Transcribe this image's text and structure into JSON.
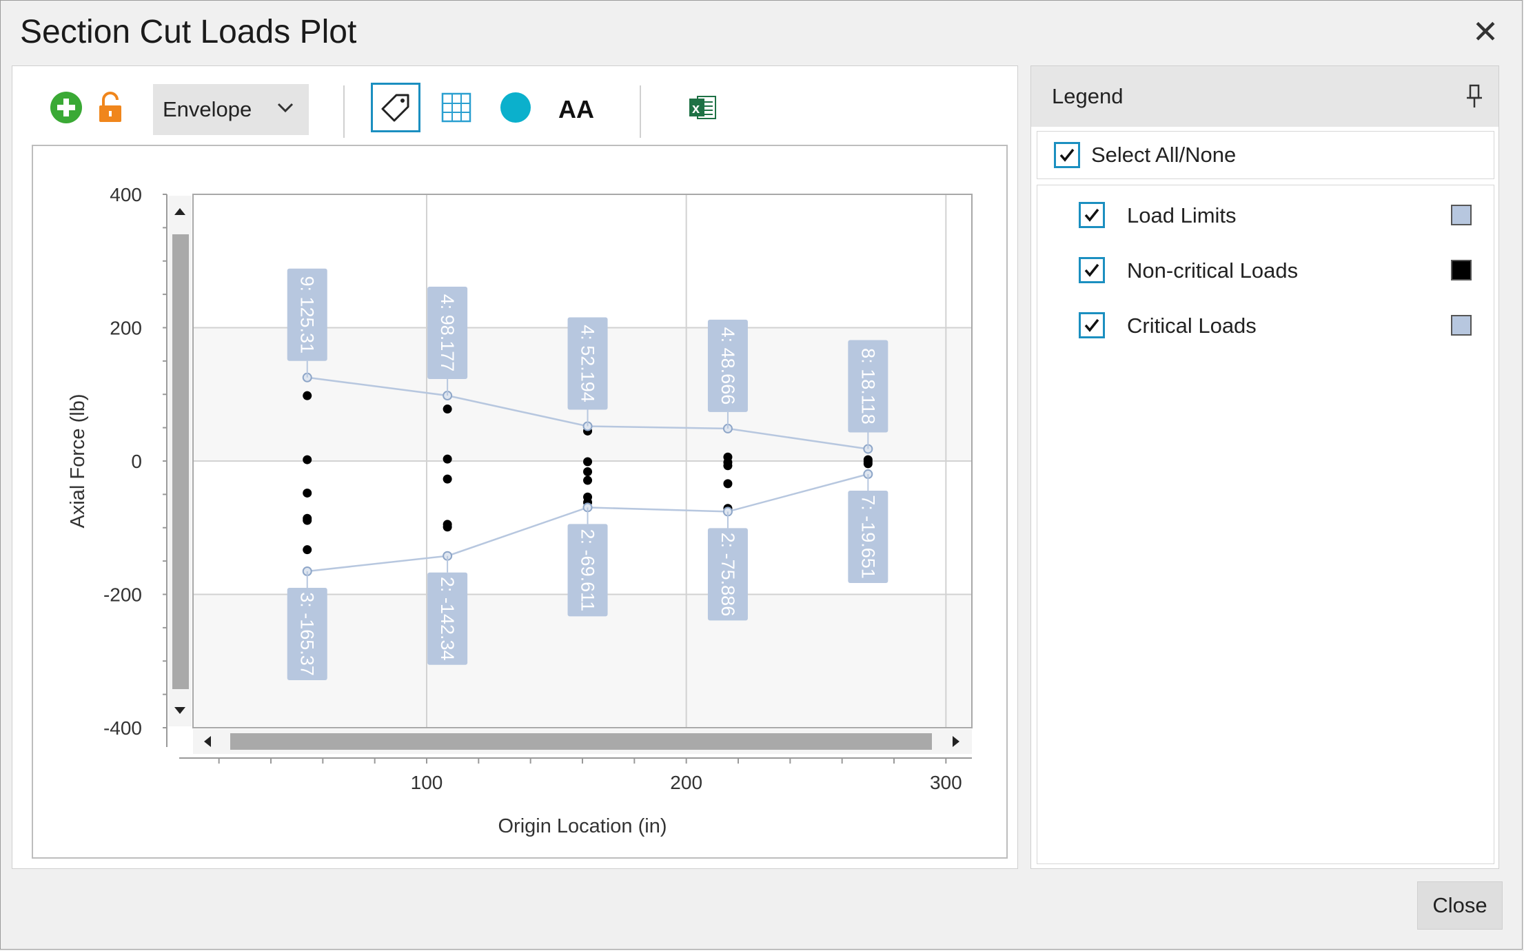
{
  "window": {
    "title": "Section Cut Loads Plot"
  },
  "toolbar": {
    "dropdown_value": "Envelope"
  },
  "legend": {
    "title": "Legend",
    "select_all_label": "Select All/None",
    "items": [
      {
        "label": "Load Limits",
        "color": "#b7c7df",
        "checked": true
      },
      {
        "label": "Non-critical Loads",
        "color": "#000000",
        "checked": true
      },
      {
        "label": "Critical Loads",
        "color": "#b7c7df",
        "checked": true
      }
    ]
  },
  "footer": {
    "close_label": "Close"
  },
  "chart_data": {
    "type": "line",
    "xlabel": "Origin Location (in)",
    "ylabel": "Axial Force (lb)",
    "xlim": [
      10,
      310
    ],
    "ylim": [
      -400,
      400
    ],
    "x_ticks": [
      100,
      200,
      300
    ],
    "y_ticks": [
      400,
      200,
      0,
      -200,
      -400
    ],
    "grid": true,
    "series": [
      {
        "name": "Load Limits",
        "x": [
          54,
          108,
          162,
          216,
          270
        ],
        "y": [
          125.31,
          98.177,
          52.194,
          48.666,
          18.118
        ],
        "labels": [
          "9: 125.31",
          "4: 98.177",
          "4: 52.194",
          "4: 48.666",
          "8: 18.118"
        ]
      },
      {
        "name": "Load Limits",
        "x": [
          54,
          108,
          162,
          216,
          270
        ],
        "y": [
          -165.37,
          -142.34,
          -69.611,
          -75.886,
          -19.651
        ],
        "labels": [
          "3: -165.37",
          "2: -142.34",
          "2: -69.611",
          "2: -75.886",
          "7: -19.651"
        ]
      },
      {
        "name": "Non-critical Loads",
        "points": [
          [
            54,
            98
          ],
          [
            54,
            2
          ],
          [
            54,
            -48
          ],
          [
            54,
            -86
          ],
          [
            54,
            -89
          ],
          [
            54,
            -133
          ],
          [
            108,
            78
          ],
          [
            108,
            3
          ],
          [
            108,
            -27
          ],
          [
            108,
            -95
          ],
          [
            108,
            -99
          ],
          [
            162,
            45
          ],
          [
            162,
            -1
          ],
          [
            162,
            -16
          ],
          [
            162,
            -29
          ],
          [
            162,
            -54
          ],
          [
            162,
            -62
          ],
          [
            216,
            6
          ],
          [
            216,
            -2
          ],
          [
            216,
            -7
          ],
          [
            216,
            -34
          ],
          [
            216,
            -71
          ],
          [
            270,
            2
          ],
          [
            270,
            -1
          ],
          [
            270,
            -4
          ]
        ]
      }
    ]
  }
}
